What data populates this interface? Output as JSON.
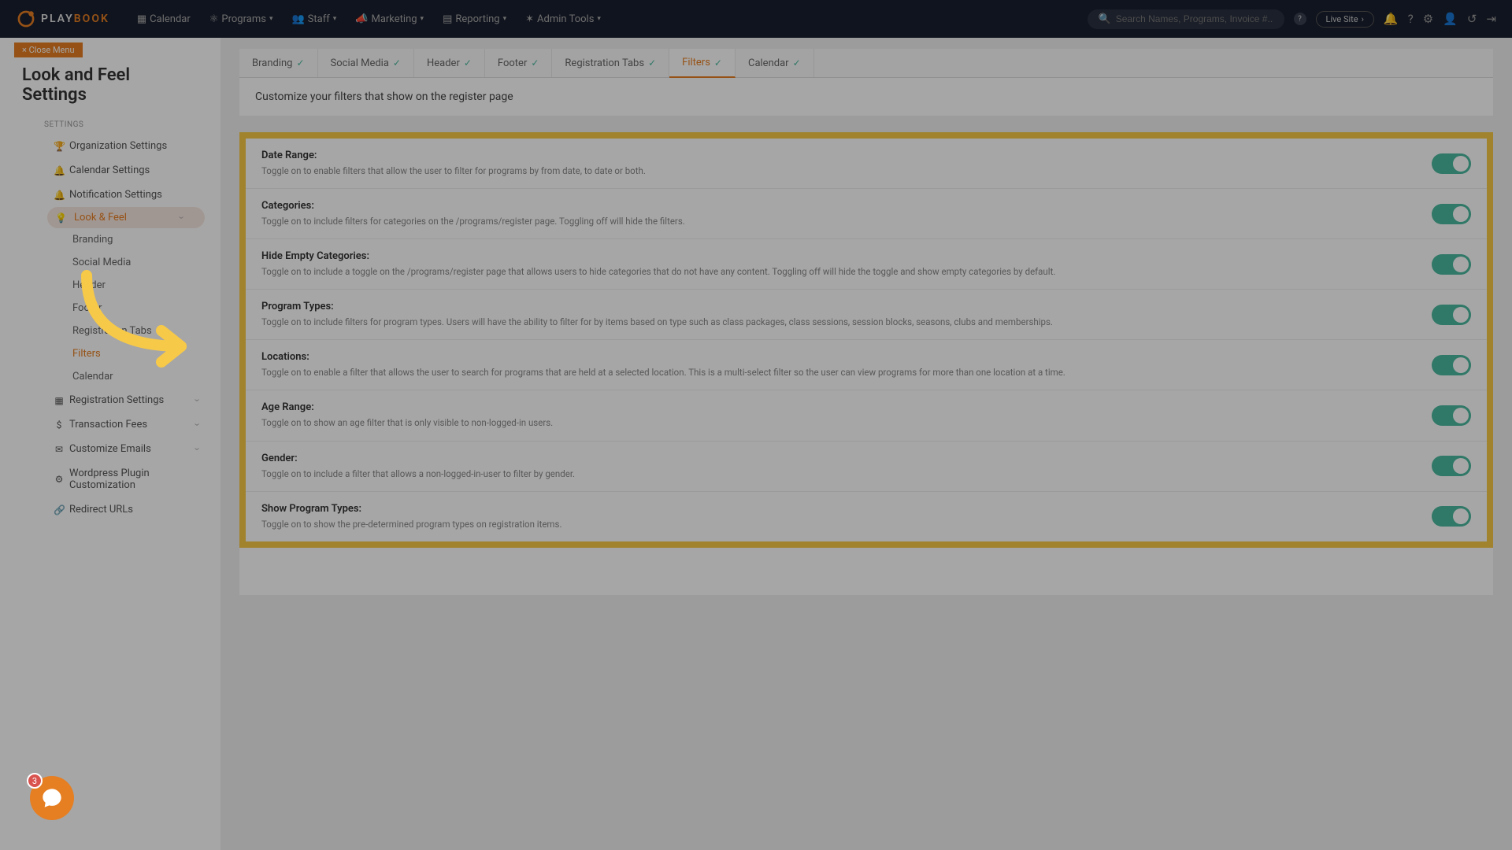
{
  "nav": {
    "logo_play": "PLAY",
    "logo_book": "BOOK",
    "items": [
      {
        "label": "Calendar",
        "icon": "📅"
      },
      {
        "label": "Programs",
        "icon": "⚙",
        "dropdown": true
      },
      {
        "label": "Staff",
        "icon": "👥",
        "dropdown": true
      },
      {
        "label": "Marketing",
        "icon": "📢",
        "dropdown": true
      },
      {
        "label": "Reporting",
        "icon": "📄",
        "dropdown": true
      },
      {
        "label": "Admin Tools",
        "icon": "✶",
        "dropdown": true
      }
    ],
    "search_placeholder": "Search Names, Programs, Invoice #...",
    "live_site": "Live Site"
  },
  "sidebar": {
    "close": "× Close Menu",
    "title": "Look and Feel Settings",
    "section": "SETTINGS",
    "items": [
      {
        "label": "Organization Settings",
        "icon": "🏆"
      },
      {
        "label": "Calendar Settings",
        "icon": "🔔"
      },
      {
        "label": "Notification Settings",
        "icon": "🔔"
      },
      {
        "label": "Look & Feel",
        "icon": "💡",
        "active": true,
        "expandable": true
      }
    ],
    "subitems": [
      {
        "label": "Branding"
      },
      {
        "label": "Social Media"
      },
      {
        "label": "Header"
      },
      {
        "label": "Footer"
      },
      {
        "label": "Registration Tabs"
      },
      {
        "label": "Filters",
        "active": true
      },
      {
        "label": "Calendar"
      }
    ],
    "items2": [
      {
        "label": "Registration Settings",
        "icon": "📋",
        "expandable": true
      },
      {
        "label": "Transaction Fees",
        "icon": "$",
        "expandable": true
      },
      {
        "label": "Customize Emails",
        "icon": "✉",
        "expandable": true
      },
      {
        "label": "Wordpress Plugin Customization",
        "icon": "⚙"
      },
      {
        "label": "Redirect URLs",
        "icon": "🔗"
      }
    ]
  },
  "tabs": [
    {
      "label": "Branding"
    },
    {
      "label": "Social Media"
    },
    {
      "label": "Header"
    },
    {
      "label": "Footer"
    },
    {
      "label": "Registration Tabs"
    },
    {
      "label": "Filters",
      "active": true
    },
    {
      "label": "Calendar"
    }
  ],
  "subtitle": "Customize your filters that show on the register page",
  "filters": [
    {
      "title": "Date Range:",
      "desc": "Toggle on to enable filters that allow the user to filter for programs by from date, to date or both.",
      "on": true
    },
    {
      "title": "Categories:",
      "desc": "Toggle on to include filters for categories on the /programs/register page. Toggling off will hide the filters.",
      "on": true
    },
    {
      "title": "Hide Empty Categories:",
      "desc": "Toggle on to include a toggle on the /programs/register page that allows users to hide categories that do not have any content. Toggling off will hide the toggle and show empty categories by default.",
      "on": true
    },
    {
      "title": "Program Types:",
      "desc": "Toggle on to include filters for program types. Users will have the ability to filter for by items based on type such as class packages, class sessions, session blocks, seasons, clubs and memberships.",
      "on": true
    },
    {
      "title": "Locations:",
      "desc": "Toggle on to enable a filter that allows the user to search for programs that are held at a selected location. This is a multi-select filter so the user can view programs for more than one location at a time.",
      "on": true
    },
    {
      "title": "Age Range:",
      "desc": "Toggle on to show an age filter that is only visible to non-logged-in users.",
      "on": true
    },
    {
      "title": "Gender:",
      "desc": "Toggle on to include a filter that allows a non-logged-in-user to filter by gender.",
      "on": true
    },
    {
      "title": "Show Program Types:",
      "desc": "Toggle on to show the pre-determined program types on registration items.",
      "on": true
    }
  ],
  "chat_badge": "3"
}
